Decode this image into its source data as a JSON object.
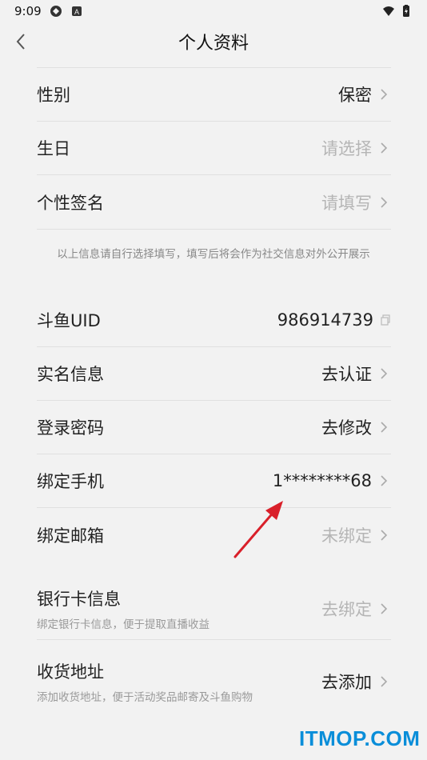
{
  "status_bar": {
    "time": "9:09"
  },
  "nav": {
    "title": "个人资料"
  },
  "profile_rows": [
    {
      "label": "性别",
      "value": "保密",
      "muted": false
    },
    {
      "label": "生日",
      "value": "请选择",
      "muted": true
    },
    {
      "label": "个性签名",
      "value": "请填写",
      "muted": true
    }
  ],
  "note": "以上信息请自行选择填写，填写后将会作为社交信息对外公开展示",
  "account_rows": [
    {
      "label": "斗鱼UID",
      "value": "986914739",
      "muted": false
    },
    {
      "label": "实名信息",
      "value": "去认证",
      "muted": false
    },
    {
      "label": "登录密码",
      "value": "去修改",
      "muted": false
    },
    {
      "label": "绑定手机",
      "value": "1********68",
      "muted": false
    },
    {
      "label": "绑定邮箱",
      "value": "未绑定",
      "muted": true
    }
  ],
  "bank": {
    "label": "银行卡信息",
    "sub": "绑定银行卡信息，便于提取直播收益",
    "value": "去绑定"
  },
  "address": {
    "label": "收货地址",
    "sub": "添加收货地址，便于活动奖品邮寄及斗鱼购物",
    "value": "去添加"
  },
  "watermark": "ITMOP.COM",
  "colors": {
    "background": "#f2f2f2",
    "muted_text": "#b5b5b5",
    "arrow": "#d9202a",
    "watermark": "#0a8ed9"
  }
}
